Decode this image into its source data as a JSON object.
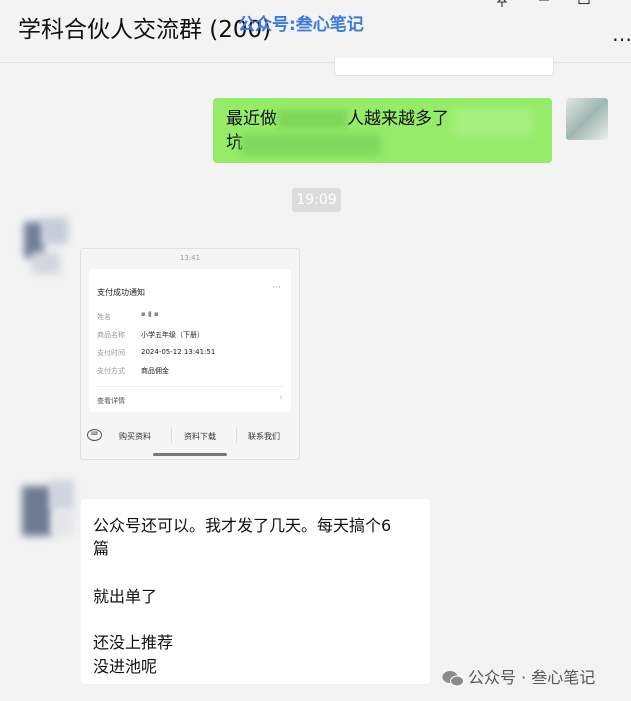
{
  "header": {
    "title": "学科合伙人交流群 (200)",
    "watermark": "公众号:叁心笔记",
    "pin_icon": "pin-icon",
    "minimize_icon": "minimize-icon",
    "maximize_icon": "maximize-icon",
    "more_label": "…"
  },
  "messages": {
    "outgoing_line1_a": "最近做",
    "outgoing_line1_b": "人越来越多了",
    "outgoing_line2": "坑",
    "time": "19:09",
    "card": {
      "status_time": "13:41",
      "title": "支付成功通知",
      "more": "···",
      "rows": [
        {
          "label": "姓名",
          "value": "▪ ▮ ▪"
        },
        {
          "label": "商品名称",
          "value": "小学五年级（下册）"
        },
        {
          "label": "支付时间",
          "value": "2024-05-12 13:41:51"
        },
        {
          "label": "支付方式",
          "value": "商品佣金"
        }
      ],
      "detail": "查看详情",
      "chevron": "›",
      "menu": [
        "购买资料",
        "资料下载",
        "联系我们"
      ],
      "keyboard_icon": "⌨"
    },
    "incoming_lines": [
      "公众号还可以。我才发了几天。每天搞个6",
      "篇",
      "就出单了",
      "还没上推荐",
      "没进池呢"
    ]
  },
  "footer": {
    "watermark": "公众号 · 叁心笔记"
  },
  "colors": {
    "green_bubble": "#95ec69",
    "background": "#f3f3f3",
    "watermark_blue": "#3d7bd9"
  }
}
